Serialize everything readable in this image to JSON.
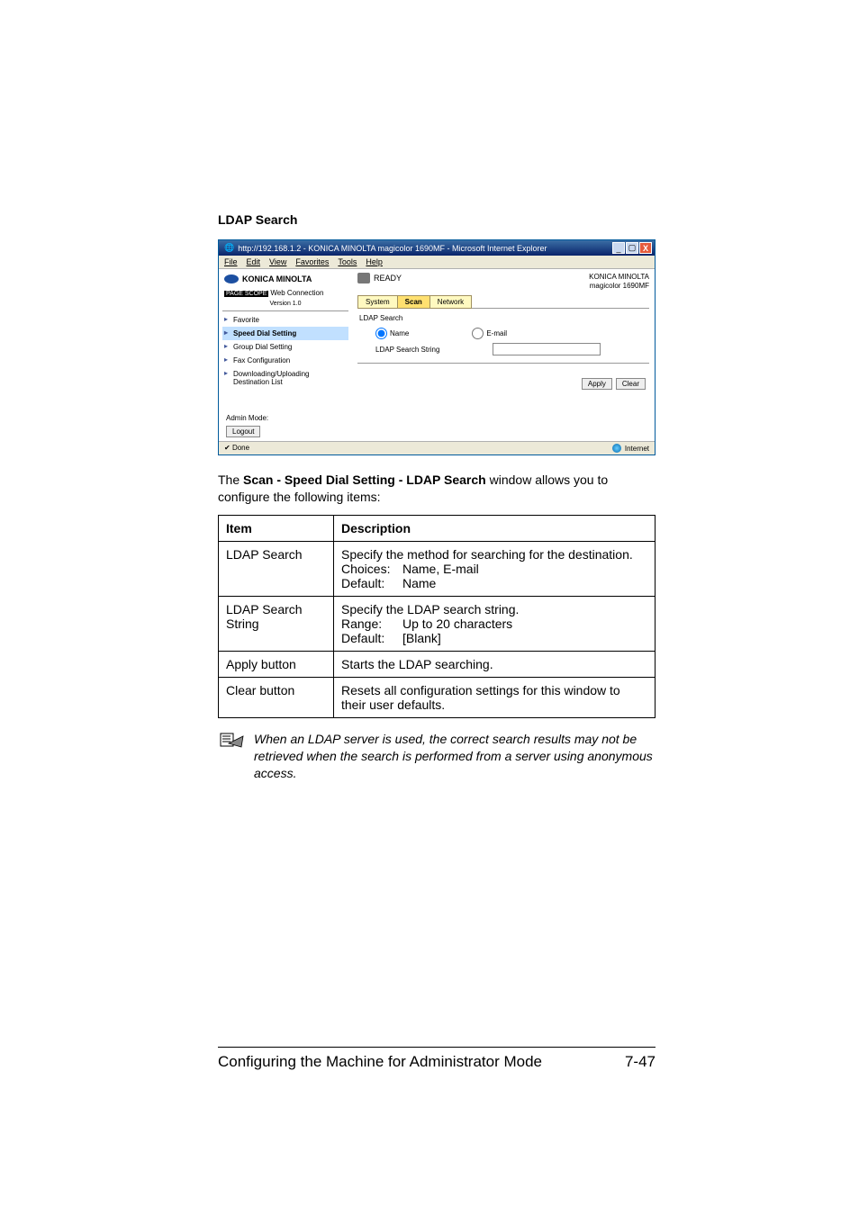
{
  "section_title": "LDAP Search",
  "ie_window": {
    "title": "http://192.168.1.2 - KONICA MINOLTA magicolor 1690MF - Microsoft Internet Explorer",
    "menu": [
      "File",
      "Edit",
      "View",
      "Favorites",
      "Tools",
      "Help"
    ],
    "ctrl_min": "_",
    "ctrl_max": "▢",
    "ctrl_close": "X"
  },
  "brand": {
    "km": "KONICA MINOLTA",
    "ps_badge": "PAGE SCOPE",
    "ps": "Web Connection",
    "version": "Version 1.0",
    "model": "magicolor 1690MF"
  },
  "ready": "READY",
  "tabs": {
    "system": "System",
    "scan": "Scan",
    "network": "Network"
  },
  "nav": {
    "favorite": "Favorite",
    "speed_dial": "Speed Dial Setting",
    "group_dial": "Group Dial Setting",
    "fax": "Fax Configuration",
    "dl": "Downloading/Uploading Destination List"
  },
  "admin_mode": "Admin Mode:",
  "logout": "Logout",
  "pane": {
    "title": "LDAP Search",
    "name": "Name",
    "email": "E-mail",
    "search_string": "LDAP Search String",
    "apply": "Apply",
    "clear": "Clear"
  },
  "statusbar": {
    "done": "Done",
    "internet": "Internet"
  },
  "intro_prefix": "The ",
  "intro_bold": "Scan - Speed Dial Setting - LDAP Search",
  "intro_suffix": " window allows you to configure the following items:",
  "table": {
    "h_item": "Item",
    "h_desc": "Description",
    "rows": [
      {
        "item": "LDAP Search",
        "desc": "Specify the method for searching for the destination.",
        "choices_label": "Choices:",
        "choices": "Name, E-mail",
        "default_label": "Default:",
        "default": "Name"
      },
      {
        "item": "LDAP Search String",
        "desc": "Specify the LDAP search string.",
        "choices_label": "Range:",
        "choices": "Up to 20 characters",
        "default_label": "Default:",
        "default": "[Blank]"
      },
      {
        "item": "Apply button",
        "desc": "Starts the LDAP searching."
      },
      {
        "item": "Clear button",
        "desc": "Resets all configuration settings for this window to their user defaults."
      }
    ]
  },
  "note": "When an LDAP server is used, the correct search results may not be retrieved when the search is performed from a server using anonymous access.",
  "footer_left": "Configuring the Machine for Administrator Mode",
  "footer_right": "7-47"
}
